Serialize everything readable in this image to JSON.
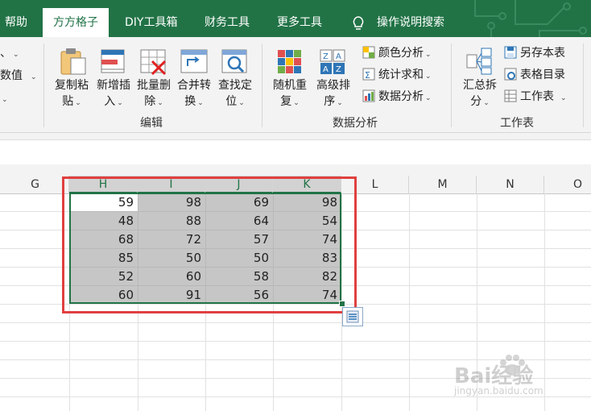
{
  "tabs": [
    "帮助",
    "方方格子",
    "DIY工具箱",
    "财务工具",
    "更多工具",
    "操作说明搜索"
  ],
  "ribbon": {
    "left_partial": [
      "、",
      "数值"
    ],
    "edit_buttons": [
      {
        "line1": "复制粘",
        "line2": "贴"
      },
      {
        "line1": "新增插",
        "line2": "入"
      },
      {
        "line1": "批量删",
        "line2": "除"
      },
      {
        "line1": "合并转",
        "line2": "换"
      },
      {
        "line1": "查找定",
        "line2": "位"
      }
    ],
    "edit_group_label": "编辑",
    "analysis_buttons": [
      {
        "line1": "随机重",
        "line2": "复"
      },
      {
        "line1": "高级排",
        "line2": "序"
      }
    ],
    "analysis_small": [
      "颜色分析",
      "统计求和",
      "数据分析"
    ],
    "analysis_group_label": "数据分析",
    "sheet_button": {
      "line1": "汇总拆",
      "line2": "分"
    },
    "sheet_small": [
      "另存本表",
      "表格目录",
      "工作表"
    ],
    "sheet_group_label": "工作表"
  },
  "columns": [
    "G",
    "H",
    "I",
    "J",
    "K",
    "L",
    "M",
    "N",
    "O"
  ],
  "cells": [
    [
      59,
      98,
      69,
      98
    ],
    [
      48,
      88,
      64,
      54
    ],
    [
      68,
      72,
      57,
      74
    ],
    [
      85,
      50,
      50,
      83
    ],
    [
      52,
      60,
      58,
      82
    ],
    [
      60,
      91,
      56,
      74
    ]
  ],
  "watermark": {
    "brand": "Bai经验",
    "url": "jingyan.baidu.com"
  }
}
